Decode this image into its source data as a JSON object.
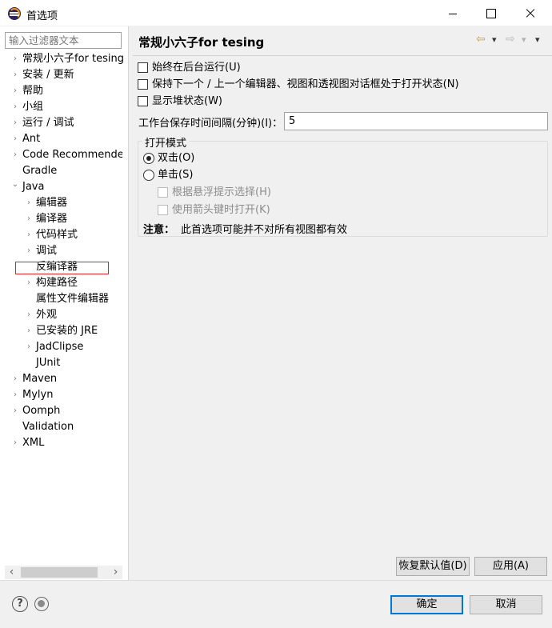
{
  "window": {
    "title": "首选项"
  },
  "filter": {
    "placeholder": "输入过滤器文本"
  },
  "tree": [
    {
      "label": "常规小六子for tesing",
      "twisty": "›"
    },
    {
      "label": "安装 / 更新",
      "twisty": "›"
    },
    {
      "label": "帮助",
      "twisty": "›"
    },
    {
      "label": "小组",
      "twisty": "›"
    },
    {
      "label": "运行 / 调试",
      "twisty": "›"
    },
    {
      "label": "Ant",
      "twisty": "›"
    },
    {
      "label": "Code Recommenders",
      "twisty": "›"
    },
    {
      "label": "Gradle",
      "twisty": ""
    },
    {
      "label": "Java",
      "twisty": "⌄"
    },
    {
      "label": "编辑器",
      "twisty": "›"
    },
    {
      "label": "编译器",
      "twisty": "›"
    },
    {
      "label": "代码样式",
      "twisty": "›"
    },
    {
      "label": "调试",
      "twisty": "›"
    },
    {
      "label": "反编译器",
      "twisty": ""
    },
    {
      "label": "构建路径",
      "twisty": "›"
    },
    {
      "label": "属性文件编辑器",
      "twisty": ""
    },
    {
      "label": "外观",
      "twisty": "›"
    },
    {
      "label": "已安装的 JRE",
      "twisty": "›"
    },
    {
      "label": "JadClipse",
      "twisty": "›"
    },
    {
      "label": "JUnit",
      "twisty": ""
    },
    {
      "label": "Maven",
      "twisty": "›"
    },
    {
      "label": "Mylyn",
      "twisty": "›"
    },
    {
      "label": "Oomph",
      "twisty": "›"
    },
    {
      "label": "Validation",
      "twisty": ""
    },
    {
      "label": "XML",
      "twisty": "›"
    }
  ],
  "page": {
    "title": "常规小六子for tesing",
    "options": [
      {
        "label": "始终在后台运行(U)",
        "checked": false
      },
      {
        "label": "保持下一个 / 上一个编辑器、视图和透视图对话框处于打开状态(N)",
        "checked": false
      },
      {
        "label": "显示堆状态(W)",
        "checked": false
      }
    ],
    "interval_label": "工作台保存时间间隔(分钟)(I)：",
    "interval_value": "5",
    "open_mode": {
      "title": "打开模式",
      "double_click": "双击(O)",
      "single_click": "单击(S)",
      "hover_select": "根据悬浮提示选择(H)",
      "arrow_open": "使用箭头键时打开(K)",
      "selected": "double_click"
    },
    "note_label": "注意：",
    "note_text": "此首选项可能并不对所有视图都有效"
  },
  "buttons": {
    "restore_defaults": "恢复默认值(D)",
    "apply": "应用(A)",
    "ok": "确定",
    "cancel": "取消"
  },
  "icons": {
    "help": "?",
    "back": "⇦",
    "forward": "⇨",
    "dropdown": "▾"
  }
}
